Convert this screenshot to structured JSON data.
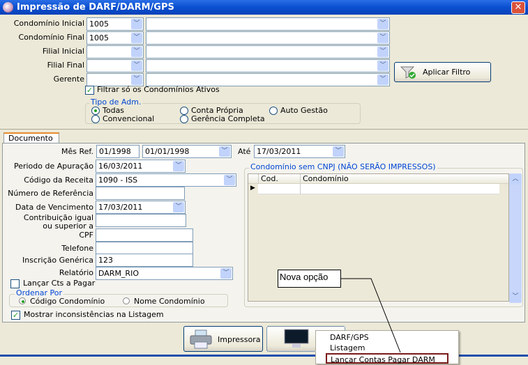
{
  "window": {
    "title": "Impressão de DARF/DARM/GPS",
    "close": "✕"
  },
  "filters": {
    "rows": [
      {
        "label": "Condomínio Inicial",
        "code": "1005",
        "name": ""
      },
      {
        "label": "Condomínio Final",
        "code": "1005",
        "name": ""
      },
      {
        "label": "Filial Inicial",
        "code": "",
        "name": ""
      },
      {
        "label": "Filial Final",
        "code": "",
        "name": ""
      },
      {
        "label": "Gerente",
        "code": "",
        "name": ""
      }
    ],
    "apply_button": "Aplicar Filtro",
    "active_only": {
      "label": "Filtrar só os Condomínios Ativos",
      "checked": true
    },
    "tipo_adm": {
      "legend": "Tipo de Adm.",
      "options": [
        "Todas",
        "Convencional",
        "Conta Própria",
        "Gerência Completa",
        "Auto Gestão"
      ],
      "selected": "Todas"
    }
  },
  "tab": {
    "label": "Documento"
  },
  "form": {
    "mes_ref": {
      "label": "Mês Ref.",
      "value": "01/1998",
      "from": "01/01/1998",
      "ate_label": "Até",
      "to": "17/03/2011"
    },
    "periodo": {
      "label": "Periodo de Apuração",
      "value": "16/03/2011"
    },
    "codigo": {
      "label": "Código da Receita",
      "value": "1090 - ISS"
    },
    "numero": {
      "label": "Número de Referência",
      "value": ""
    },
    "vencimento": {
      "label": "Data de Vencimento",
      "value": "17/03/2011"
    },
    "contribuicao": {
      "label1": "Contribuição igual",
      "label2": "ou superior a",
      "value": ""
    },
    "cpf": {
      "label": "CPF",
      "value": ""
    },
    "telefone": {
      "label": "Telefone",
      "value": ""
    },
    "inscricao": {
      "label": "Inscrição Genérica",
      "value": "123"
    },
    "relatorio": {
      "label": "Relatório",
      "value": "DARM_RIO"
    },
    "lancar": {
      "label": "Lançar Cts a Pagar",
      "checked": false
    },
    "ordenar": {
      "legend": "Ordenar Por",
      "options": [
        "Código Condomínio",
        "Nome Condomínio"
      ],
      "selected": "Código Condomínio"
    },
    "mostrar": {
      "label": "Mostrar inconsistências na Listagem",
      "checked": true
    }
  },
  "grid": {
    "legend": "Condomínio sem CNPJ (NÃO SERÃO IMPRESSOS)",
    "columns": [
      "Cod.",
      "Condomínio"
    ]
  },
  "buttons": {
    "impressora": "Impressora",
    "tela": "T"
  },
  "menu": {
    "items": [
      "DARF/GPS",
      "Listagem",
      "Lançar Contas Pagar DARM"
    ],
    "highlighted": "Lançar Contas Pagar DARM"
  },
  "callout": {
    "text": "Nova opção"
  }
}
